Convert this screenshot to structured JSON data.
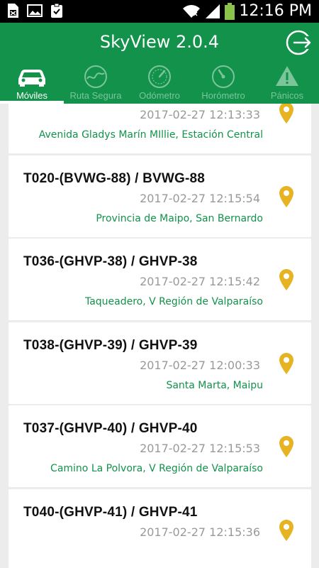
{
  "status_bar": {
    "time": "12:16 PM"
  },
  "app": {
    "title": "SkyView 2.0.4"
  },
  "tabs": [
    {
      "label": "Móviles",
      "icon": "car-icon",
      "active": true
    },
    {
      "label": "Ruta Segura",
      "icon": "route-icon",
      "active": false
    },
    {
      "label": "Odómetro",
      "icon": "speedometer-icon",
      "active": false
    },
    {
      "label": "Horómetro",
      "icon": "gauge-icon",
      "active": false
    },
    {
      "label": "Pánicos",
      "icon": "warning-icon",
      "active": false
    }
  ],
  "vehicles": [
    {
      "name": "",
      "timestamp": "2017-02-27 12:13:33",
      "address": "Avenida Gladys Marín MIllie, Estación Central"
    },
    {
      "name": "T020-(BVWG-88) / BVWG-88",
      "timestamp": "2017-02-27 12:15:54",
      "address": "Provincia de Maipo, San Bernardo"
    },
    {
      "name": "T036-(GHVP-38) / GHVP-38",
      "timestamp": "2017-02-27 12:15:42",
      "address": "Taqueadero, V Región de Valparaíso"
    },
    {
      "name": "T038-(GHVP-39) / GHVP-39",
      "timestamp": "2017-02-27 12:00:33",
      "address": "Santa Marta, Maipu"
    },
    {
      "name": "T037-(GHVP-40) / GHVP-40",
      "timestamp": "2017-02-27 12:15:53",
      "address": "Camino La Polvora, V Región de Valparaíso"
    },
    {
      "name": "T040-(GHVP-41) / GHVP-41",
      "timestamp": "2017-02-27 12:15:36",
      "address": ""
    }
  ],
  "colors": {
    "primary": "#12924a",
    "pin": "#e6b422",
    "address": "#12924a"
  }
}
